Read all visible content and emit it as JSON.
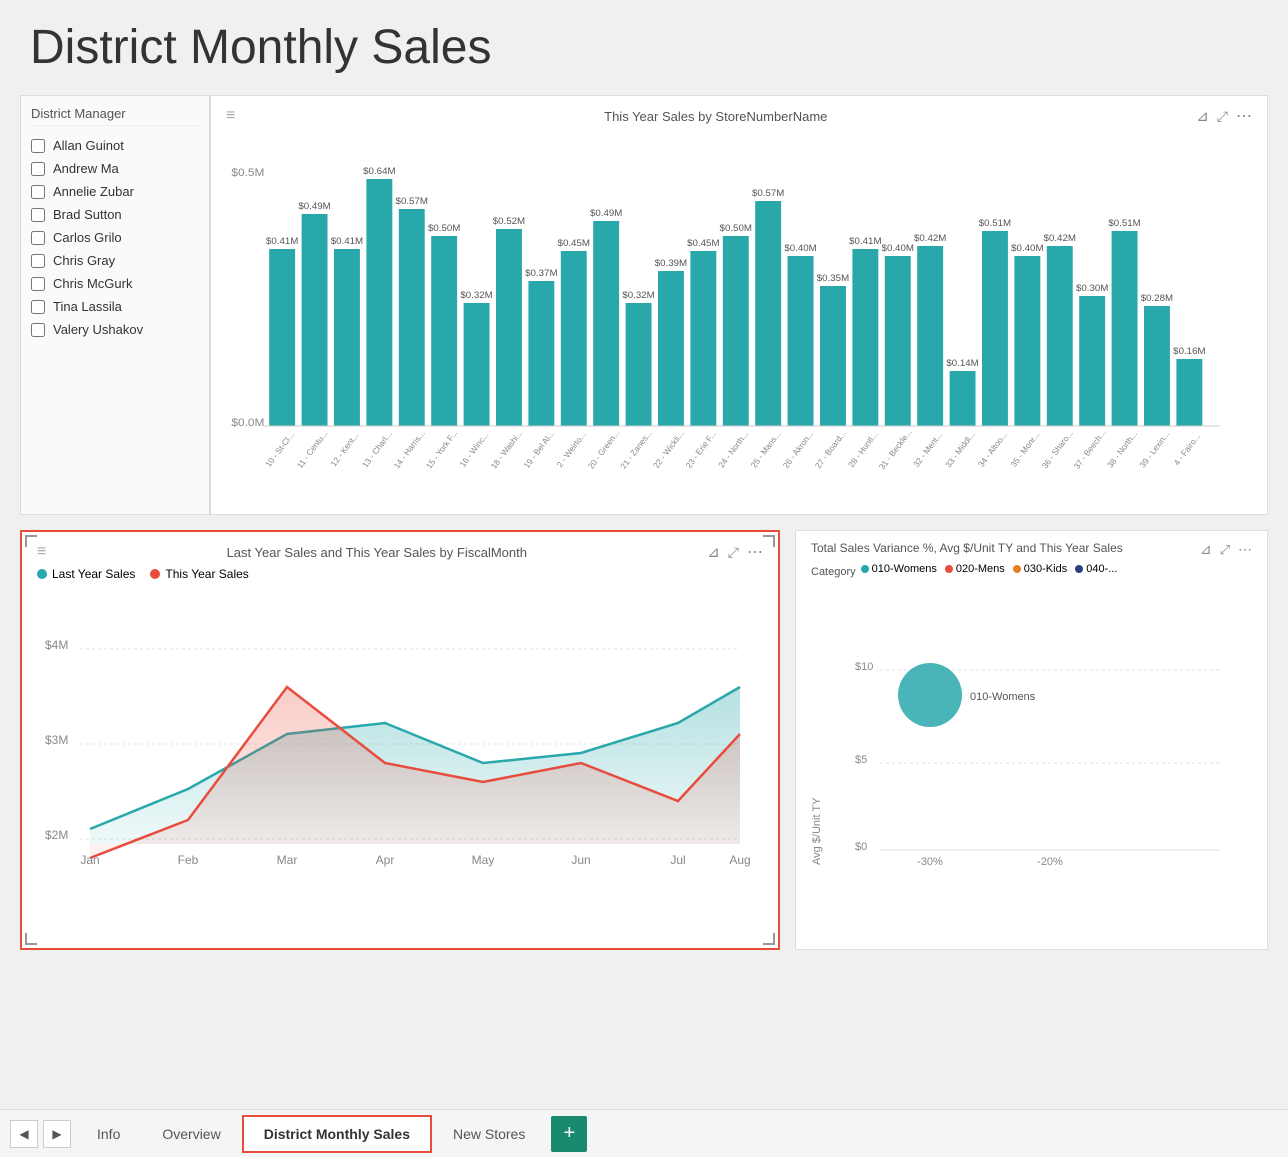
{
  "page": {
    "title": "District Monthly Sales"
  },
  "filter": {
    "title": "District Manager",
    "items": [
      {
        "label": "Allan Guinot",
        "checked": false,
        "partial": false
      },
      {
        "label": "Andrew Ma",
        "checked": false,
        "partial": false
      },
      {
        "label": "Annelie Zubar",
        "checked": false,
        "partial": false
      },
      {
        "label": "Brad Sutton",
        "checked": false,
        "partial": false
      },
      {
        "label": "Carlos Grilo",
        "checked": false,
        "partial": true
      },
      {
        "label": "Chris Gray",
        "checked": false,
        "partial": false
      },
      {
        "label": "Chris McGurk",
        "checked": false,
        "partial": false
      },
      {
        "label": "Tina Lassila",
        "checked": false,
        "partial": false
      },
      {
        "label": "Valery Ushakov",
        "checked": false,
        "partial": false
      }
    ]
  },
  "bar_chart": {
    "title": "This Year Sales by StoreNumberName",
    "bars": [
      {
        "label": "10 - St-Cl...",
        "value": 0.41,
        "display": "$0.41M"
      },
      {
        "label": "11 - Centu...",
        "value": 0.49,
        "display": "$0.49M"
      },
      {
        "label": "12 - Kent...",
        "value": 0.41,
        "display": "$0.41M"
      },
      {
        "label": "13 - Charl...",
        "value": 0.64,
        "display": "$0.64M"
      },
      {
        "label": "14 - Harris...",
        "value": 0.57,
        "display": "$0.57M"
      },
      {
        "label": "15 - York F...",
        "value": 0.5,
        "display": "$0.50M"
      },
      {
        "label": "16 - Winc...",
        "value": 0.32,
        "display": "$0.32M"
      },
      {
        "label": "18 - Washi...",
        "value": 0.52,
        "display": "$0.52M"
      },
      {
        "label": "19 - Bel Al...",
        "value": 0.37,
        "display": "$0.37M"
      },
      {
        "label": "2 - Weirto...",
        "value": 0.45,
        "display": "$0.45M"
      },
      {
        "label": "20 - Green...",
        "value": 0.49,
        "display": "$0.49M"
      },
      {
        "label": "21 - Zanes...",
        "value": 0.32,
        "display": "$0.32M"
      },
      {
        "label": "22 - Wickli...",
        "value": 0.39,
        "display": "$0.39M"
      },
      {
        "label": "23 - Erie F...",
        "value": 0.45,
        "display": "$0.45M"
      },
      {
        "label": "24 - North...",
        "value": 0.5,
        "display": "$0.50M"
      },
      {
        "label": "25 - Mans...",
        "value": 0.57,
        "display": "$0.57M"
      },
      {
        "label": "26 - Akron...",
        "value": 0.4,
        "display": "$0.40M"
      },
      {
        "label": "27 - Board...",
        "value": 0.35,
        "display": "$0.35M"
      },
      {
        "label": "28 - Huntl...",
        "value": 0.41,
        "display": "$0.41M"
      },
      {
        "label": "31 - Beckle...",
        "value": 0.4,
        "display": "$0.40M"
      },
      {
        "label": "32 - Ment...",
        "value": 0.42,
        "display": "$0.42M"
      },
      {
        "label": "33 - Middl...",
        "value": 0.14,
        "display": "$0.14M"
      },
      {
        "label": "34 - Altoo...",
        "value": 0.51,
        "display": "$0.51M"
      },
      {
        "label": "35 - Monr...",
        "value": 0.4,
        "display": "$0.40M"
      },
      {
        "label": "36 - Sharo...",
        "value": 0.42,
        "display": "$0.42M"
      },
      {
        "label": "37 - Beech...",
        "value": 0.3,
        "display": "$0.30M"
      },
      {
        "label": "38 - North...",
        "value": 0.51,
        "display": "$0.51M"
      },
      {
        "label": "39 - Lexin...",
        "value": 0.28,
        "display": "$0.28M"
      },
      {
        "label": "4 - Fairo...",
        "value": 0.16,
        "display": "$0.16M"
      }
    ],
    "y_axis": [
      "$0.0M",
      "$0.5M"
    ],
    "bar_color": "#29a8ab"
  },
  "line_chart": {
    "title": "Last Year Sales and This Year Sales by FiscalMonth",
    "legend": [
      {
        "label": "Last Year Sales",
        "color": "#29a8ab"
      },
      {
        "label": "This Year Sales",
        "color": "#e74c3c"
      }
    ],
    "y_axis": [
      "$2M",
      "$3M",
      "$4M"
    ],
    "x_axis": [
      "Jan",
      "Feb",
      "Mar",
      "Apr",
      "May",
      "Jun",
      "Jul",
      "Aug"
    ],
    "last_year": [
      2.1,
      2.5,
      3.1,
      3.2,
      2.8,
      2.9,
      3.2,
      3.6
    ],
    "this_year": [
      1.8,
      2.2,
      3.6,
      2.8,
      2.6,
      2.8,
      2.4,
      3.1
    ]
  },
  "scatter_chart": {
    "title": "Total Sales Variance %, Avg $/Unit TY and This Year Sales",
    "category_label": "Category",
    "legend": [
      {
        "label": "010-Womens",
        "color": "#29a8ab"
      },
      {
        "label": "020-Mens",
        "color": "#e74c3c"
      },
      {
        "label": "030-Kids",
        "color": "#e67e22"
      },
      {
        "label": "040-...",
        "color": "#2c3e7f"
      }
    ],
    "y_axis_label": "Avg $/Unit TY",
    "y_axis": [
      "$0",
      "$5",
      "$10"
    ],
    "x_axis": [
      "-30%",
      "-20%"
    ],
    "bubbles": [
      {
        "x": 30,
        "y": 65,
        "r": 28,
        "label": "010-Womens",
        "color": "#29a8ab"
      }
    ]
  },
  "tabs": {
    "items": [
      {
        "label": "Info",
        "active": false
      },
      {
        "label": "Overview",
        "active": false
      },
      {
        "label": "District Monthly Sales",
        "active": true
      },
      {
        "label": "New Stores",
        "active": false
      }
    ],
    "add_label": "+"
  }
}
